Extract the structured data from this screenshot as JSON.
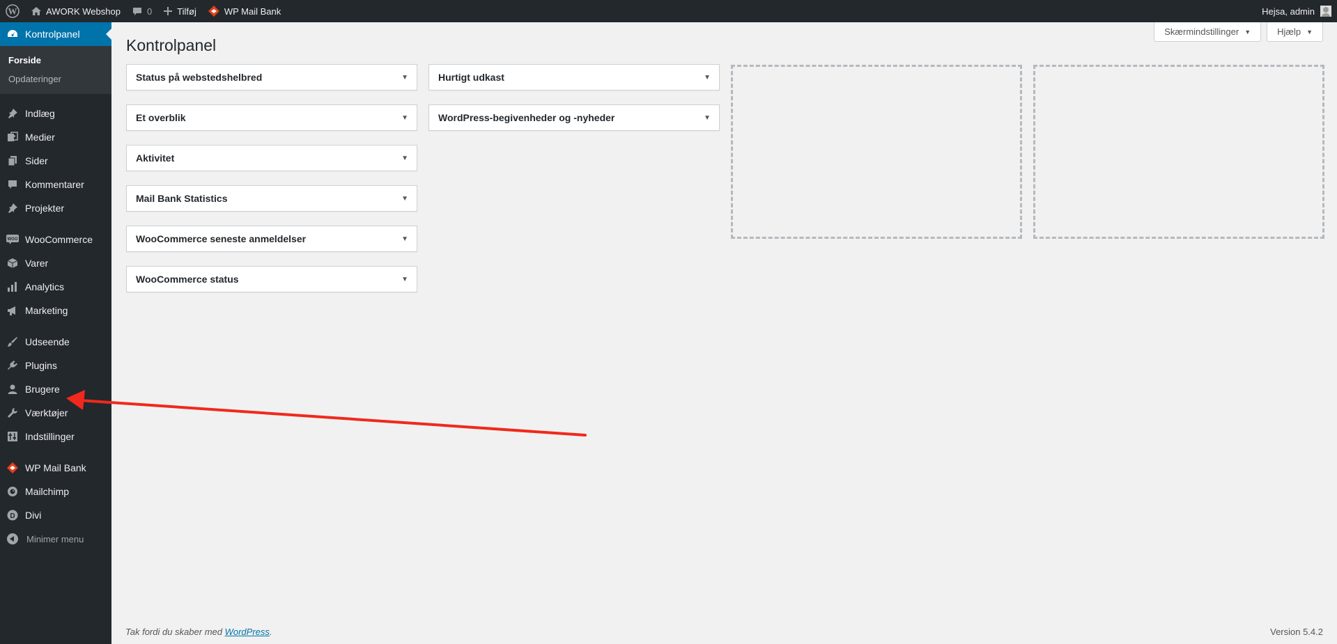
{
  "adminbar": {
    "site_name": "AWORK Webshop",
    "comments_count": "0",
    "add_new": "Tilføj",
    "plugin_link": "WP Mail Bank",
    "greeting": "Hejsa, admin"
  },
  "sidebar": {
    "dashboard": "Kontrolpanel",
    "submenu": {
      "home": "Forside",
      "updates": "Opdateringer"
    },
    "items": [
      {
        "label": "Indlæg",
        "icon": "pin-icon"
      },
      {
        "label": "Medier",
        "icon": "media-icon"
      },
      {
        "label": "Sider",
        "icon": "pages-icon"
      },
      {
        "label": "Kommentarer",
        "icon": "comments-icon"
      },
      {
        "label": "Projekter",
        "icon": "pin-icon"
      },
      {
        "label": "WooCommerce",
        "icon": "woo-icon"
      },
      {
        "label": "Varer",
        "icon": "products-icon"
      },
      {
        "label": "Analytics",
        "icon": "analytics-icon"
      },
      {
        "label": "Marketing",
        "icon": "megaphone-icon"
      },
      {
        "label": "Udseende",
        "icon": "brush-icon"
      },
      {
        "label": "Plugins",
        "icon": "plugin-icon"
      },
      {
        "label": "Brugere",
        "icon": "user-icon"
      },
      {
        "label": "Værktøjer",
        "icon": "wrench-icon"
      },
      {
        "label": "Indstillinger",
        "icon": "settings-icon"
      },
      {
        "label": "WP Mail Bank",
        "icon": "mail-bank-icon"
      },
      {
        "label": "Mailchimp",
        "icon": "mailchimp-icon"
      },
      {
        "label": "Divi",
        "icon": "divi-icon"
      }
    ],
    "collapse": "Minimer menu"
  },
  "header": {
    "title": "Kontrolpanel",
    "screen_options": "Skærmindstillinger",
    "help": "Hjælp"
  },
  "widgets": {
    "column1": [
      "Status på webstedshelbred",
      "Et overblik",
      "Aktivitet",
      "Mail Bank Statistics",
      "WooCommerce seneste anmeldelser",
      "WooCommerce status"
    ],
    "column2": [
      "Hurtigt udkast",
      "WordPress-begivenheder og -nyheder"
    ]
  },
  "footer": {
    "thanks_prefix": "Tak fordi du skaber med ",
    "thanks_link": "WordPress",
    "thanks_suffix": ".",
    "version": "Version 5.4.2"
  },
  "colors": {
    "adminbar_bg": "#23282d",
    "menu_current": "#0073aa",
    "annotation_arrow": "#f0291c"
  }
}
